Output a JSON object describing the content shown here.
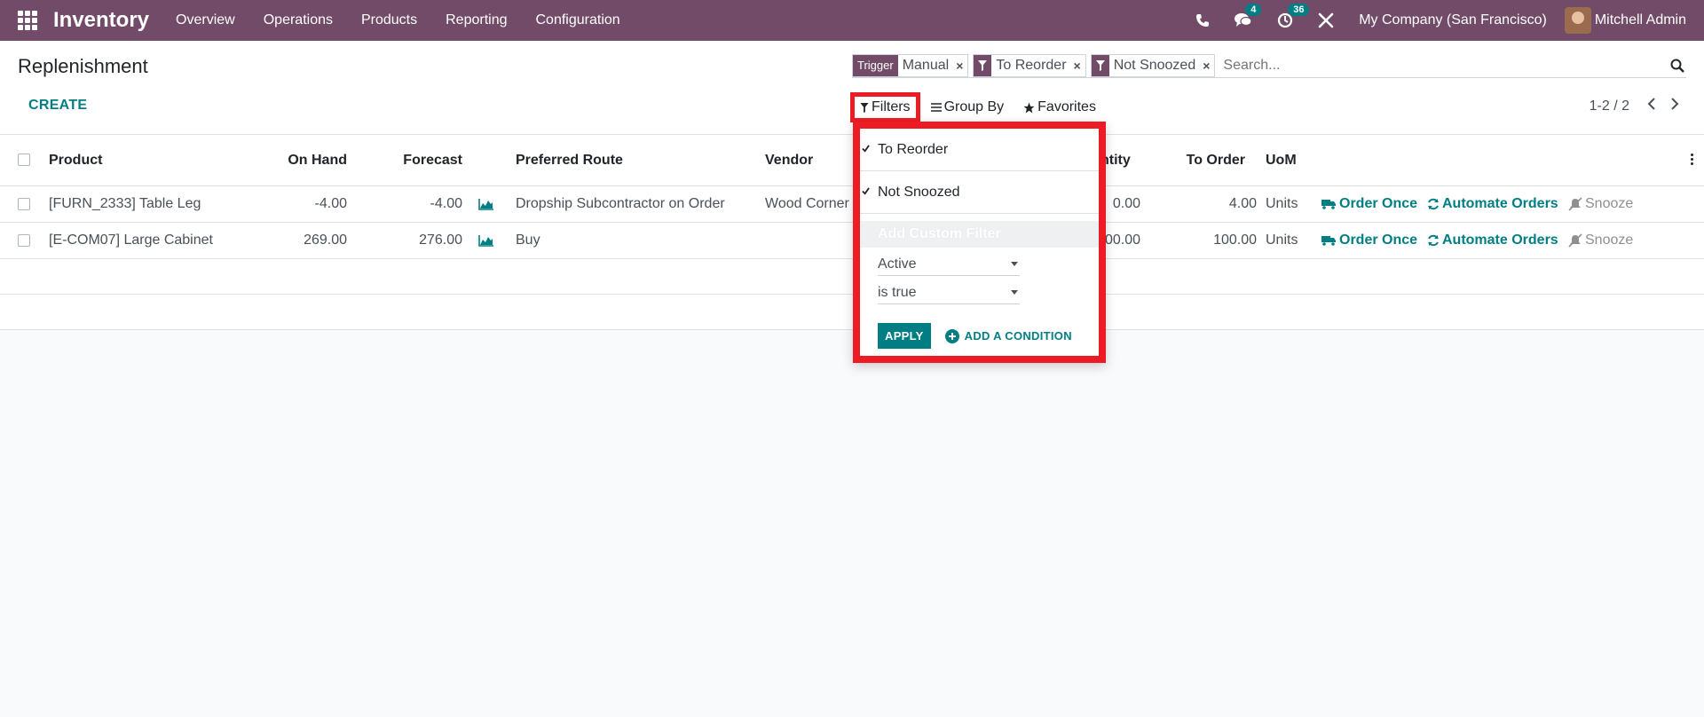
{
  "navbar": {
    "app_name": "Inventory",
    "menu": [
      "Overview",
      "Operations",
      "Products",
      "Reporting",
      "Configuration"
    ],
    "messages_count": "4",
    "activities_count": "36",
    "company": "My Company (San Francisco)",
    "user": "Mitchell Admin",
    "color": "#714b67"
  },
  "control": {
    "title": "Replenishment",
    "create_label": "CREATE",
    "facets": [
      {
        "label": "Trigger",
        "value": "Manual"
      },
      {
        "label": "filter-icon",
        "value": "To Reorder"
      },
      {
        "label": "filter-icon",
        "value": "Not Snoozed"
      }
    ],
    "search_placeholder": "Search...",
    "filters_label": "Filters",
    "group_by_label": "Group By",
    "favorites_label": "Favorites",
    "pager_value": "1-2 / 2"
  },
  "table": {
    "headers": {
      "product": "Product",
      "on_hand": "On Hand",
      "forecast": "Forecast",
      "route": "Preferred Route",
      "vendor": "Vendor",
      "quantity": "ntity",
      "to_order": "To Order",
      "uom": "UoM"
    },
    "rows": [
      {
        "product": "[FURN_2333] Table Leg",
        "on_hand": "-4.00",
        "forecast": "-4.00",
        "route": "Dropship Subcontractor on Order",
        "vendor": "Wood Corner",
        "quantity": "0.00",
        "to_order": "4.00",
        "uom": "Units",
        "order_once": "Order Once",
        "automate": "Automate Orders",
        "snooze": "Snooze"
      },
      {
        "product": "[E-COM07] Large Cabinet",
        "on_hand": "269.00",
        "forecast": "276.00",
        "route": "Buy",
        "vendor": "",
        "quantity": "00.00",
        "to_order": "100.00",
        "uom": "Units",
        "order_once": "Order Once",
        "automate": "Automate Orders",
        "snooze": "Snooze"
      }
    ]
  },
  "dropdown": {
    "items": [
      "To Reorder",
      "Not Snoozed"
    ],
    "custom_filter_label": "Add Custom Filter",
    "field_value": "Active",
    "operator_value": "is true",
    "apply_label": "APPLY",
    "add_condition_label": "ADD A CONDITION",
    "highlight_color": "#ed1c24"
  }
}
